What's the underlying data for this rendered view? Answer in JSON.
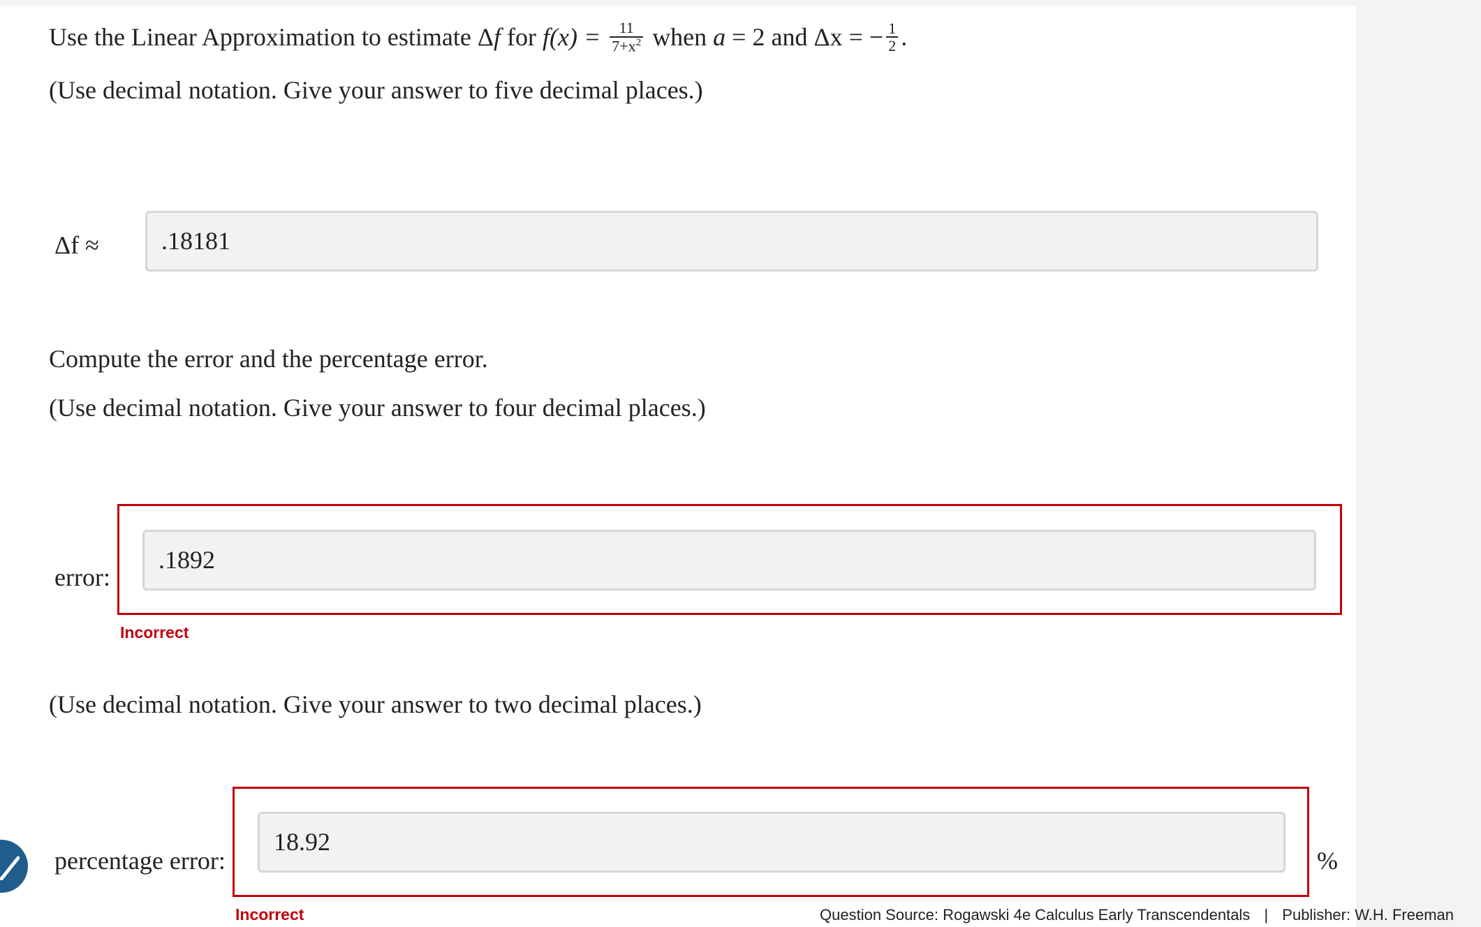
{
  "question": {
    "intro": "Use the Linear Approximation to estimate",
    "delta_f": "Δ",
    "f_var": "f",
    "for_word": "for",
    "fx": "f(x) =",
    "frac_num": "11",
    "frac_den_base": "7+x",
    "frac_den_exp": "2",
    "when_a": "when",
    "a_var": "a",
    "a_eq": "= 2 and",
    "dx": "Δx",
    "dx_eq": "= −",
    "dx_num": "1",
    "dx_den": "2",
    "period": ".",
    "instruction1": "(Use decimal notation. Give your answer to five decimal places.)"
  },
  "answer1": {
    "label": "Δf ≈",
    "value": ".18181"
  },
  "part2": {
    "prompt": "Compute the error and the percentage error.",
    "instruction": "(Use decimal notation. Give your answer to four decimal places.)"
  },
  "answer2": {
    "label": "error:",
    "value": ".1892",
    "status": "Incorrect"
  },
  "part3": {
    "instruction": "(Use decimal notation. Give your answer to two decimal places.)"
  },
  "answer3": {
    "label": "percentage error:",
    "value": "18.92",
    "unit": "%",
    "status": "Incorrect"
  },
  "footer": {
    "source": "Question Source: Rogawski 4e Calculus Early Transcendentals",
    "separator": "|",
    "publisher": "Publisher: W.H. Freeman"
  },
  "colors": {
    "error": "#c2000b",
    "field_bg": "#f2f2f2",
    "badge": "#1f5e8c"
  },
  "icons": {
    "status_badge": "checkmark-icon"
  }
}
